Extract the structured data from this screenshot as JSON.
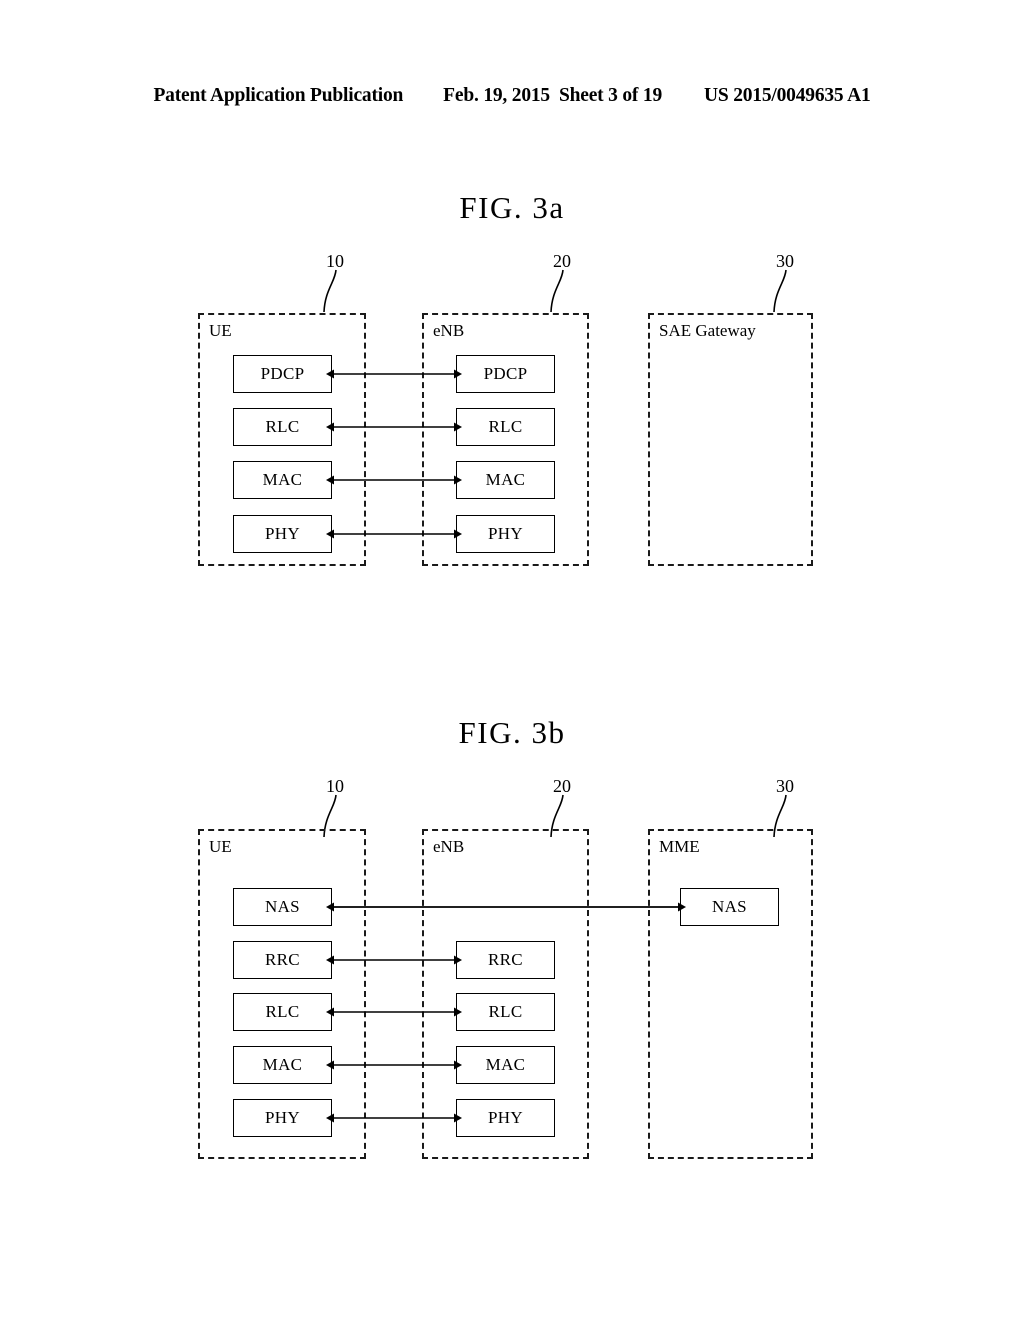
{
  "header": {
    "publication": "Patent Application Publication",
    "date": "Feb. 19, 2015",
    "sheet": "Sheet 3 of 19",
    "patent_number": "US 2015/0049635 A1"
  },
  "figures": [
    {
      "id": "3a",
      "title": "FIG. 3a",
      "entities": [
        {
          "label": "UE",
          "ref": "10"
        },
        {
          "label": "eNB",
          "ref": "20"
        },
        {
          "label": "SAE Gateway",
          "ref": "30"
        }
      ],
      "ue_layers": [
        "PDCP",
        "RLC",
        "MAC",
        "PHY"
      ],
      "enb_layers": [
        "PDCP",
        "RLC",
        "MAC",
        "PHY"
      ],
      "gateway_layers": [],
      "connections": [
        {
          "from": "PDCP",
          "to": "PDCP",
          "style": "double-arrow"
        },
        {
          "from": "RLC",
          "to": "RLC",
          "style": "double-arrow"
        },
        {
          "from": "MAC",
          "to": "MAC",
          "style": "double-arrow"
        },
        {
          "from": "PHY",
          "to": "PHY",
          "style": "double-arrow"
        }
      ]
    },
    {
      "id": "3b",
      "title": "FIG. 3b",
      "entities": [
        {
          "label": "UE",
          "ref": "10"
        },
        {
          "label": "eNB",
          "ref": "20"
        },
        {
          "label": "MME",
          "ref": "30"
        }
      ],
      "ue_layers": [
        "NAS",
        "RRC",
        "RLC",
        "MAC",
        "PHY"
      ],
      "enb_layers": [
        "RRC",
        "RLC",
        "MAC",
        "PHY"
      ],
      "mme_layers": [
        "NAS"
      ],
      "connections": [
        {
          "from": "NAS",
          "to": "NAS",
          "style": "double-arrow",
          "span": "ue-to-mme"
        },
        {
          "from": "RRC",
          "to": "RRC",
          "style": "double-arrow",
          "span": "ue-to-enb"
        },
        {
          "from": "RLC",
          "to": "RLC",
          "style": "double-arrow",
          "span": "ue-to-enb"
        },
        {
          "from": "MAC",
          "to": "MAC",
          "style": "double-arrow",
          "span": "ue-to-enb"
        },
        {
          "from": "PHY",
          "to": "PHY",
          "style": "double-arrow",
          "span": "ue-to-enb"
        }
      ]
    }
  ],
  "colors": {
    "ink": "#000000",
    "paper": "#ffffff"
  }
}
